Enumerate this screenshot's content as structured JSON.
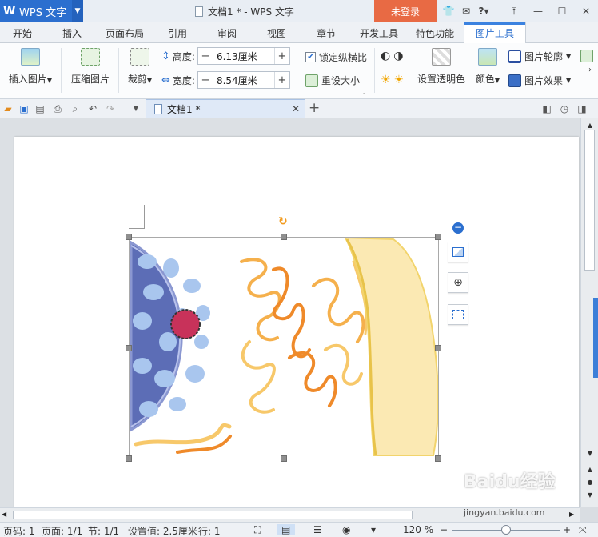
{
  "titlebar": {
    "app_name": "WPS 文字",
    "document_title": "文档1 * - WPS 文字",
    "login_label": "未登录",
    "help_label": "?"
  },
  "tabs": [
    "开始",
    "插入",
    "页面布局",
    "引用",
    "审阅",
    "视图",
    "章节",
    "开发工具",
    "特色功能",
    "图片工具"
  ],
  "ribbon": {
    "insert_picture": "插入图片",
    "compress_picture": "压缩图片",
    "crop": "裁剪",
    "height_label": "高度:",
    "height_value": "6.13厘米",
    "width_label": "宽度:",
    "width_value": "8.54厘米",
    "lock_ratio": "锁定纵横比",
    "reset_size": "重设大小",
    "set_transparent": "设置透明色",
    "color": "颜色",
    "picture_outline": "图片轮廓",
    "picture_effect": "图片效果"
  },
  "quick_access": {
    "doc_tab_label": "文档1 *"
  },
  "statusbar": {
    "page_code": "页码: 1",
    "pages": "页面: 1/1",
    "section": "节: 1/1",
    "setting": "设置值: 2.5厘米",
    "row": "行: 1",
    "zoom": "120 %"
  },
  "watermark": {
    "brand": "Baidu经验",
    "url": "jingyan.baidu.com"
  },
  "colors": {
    "accent": "#2b6fcf",
    "login": "#e86a44"
  }
}
